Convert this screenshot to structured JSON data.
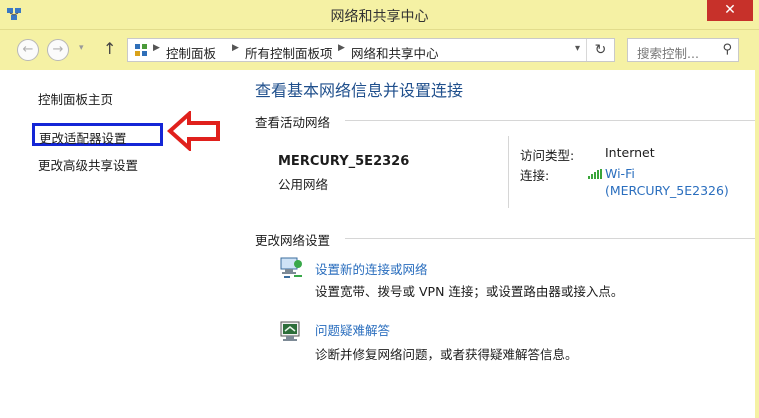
{
  "window": {
    "title": "网络和共享中心",
    "close_glyph": "✕"
  },
  "toolbar": {
    "back_glyph": "←",
    "forward_glyph": "→",
    "recent_glyph": "▾",
    "up_glyph": "↑",
    "breadcrumb": [
      "控制面板",
      "所有控制面板项",
      "网络和共享中心"
    ],
    "sep_glyph": "▶",
    "dropdown_glyph": "▾",
    "refresh_glyph": "↻",
    "search_placeholder": "搜索控制...",
    "search_glyph": "⚲"
  },
  "sidebar": {
    "items": [
      {
        "label": "控制面板主页"
      },
      {
        "label": "更改适配器设置"
      },
      {
        "label": "更改高级共享设置"
      }
    ]
  },
  "main": {
    "heading": "查看基本网络信息并设置连接",
    "active_section": "查看活动网络",
    "network_name": "MERCURY_5E2326",
    "network_type": "公用网络",
    "access_label": "访问类型:",
    "access_value": "Internet",
    "conn_label": "连接:",
    "conn_line1": "Wi-Fi",
    "conn_line2": "(MERCURY_5E2326)",
    "change_section": "更改网络设置",
    "tasks": [
      {
        "title": "设置新的连接或网络",
        "desc": "设置宽带、拨号或 VPN 连接；或设置路由器或接入点。",
        "icon": "network-setup-icon"
      },
      {
        "title": "问题疑难解答",
        "desc": "诊断并修复网络问题，或者获得疑难解答信息。",
        "icon": "troubleshoot-icon"
      }
    ]
  },
  "colors": {
    "titlebar": "#f5f1a4",
    "link": "#2a6ebe",
    "heading": "#1f4f8c",
    "highlight_box": "#1426d6",
    "arrow": "#e0201c",
    "close": "#c7312a"
  }
}
